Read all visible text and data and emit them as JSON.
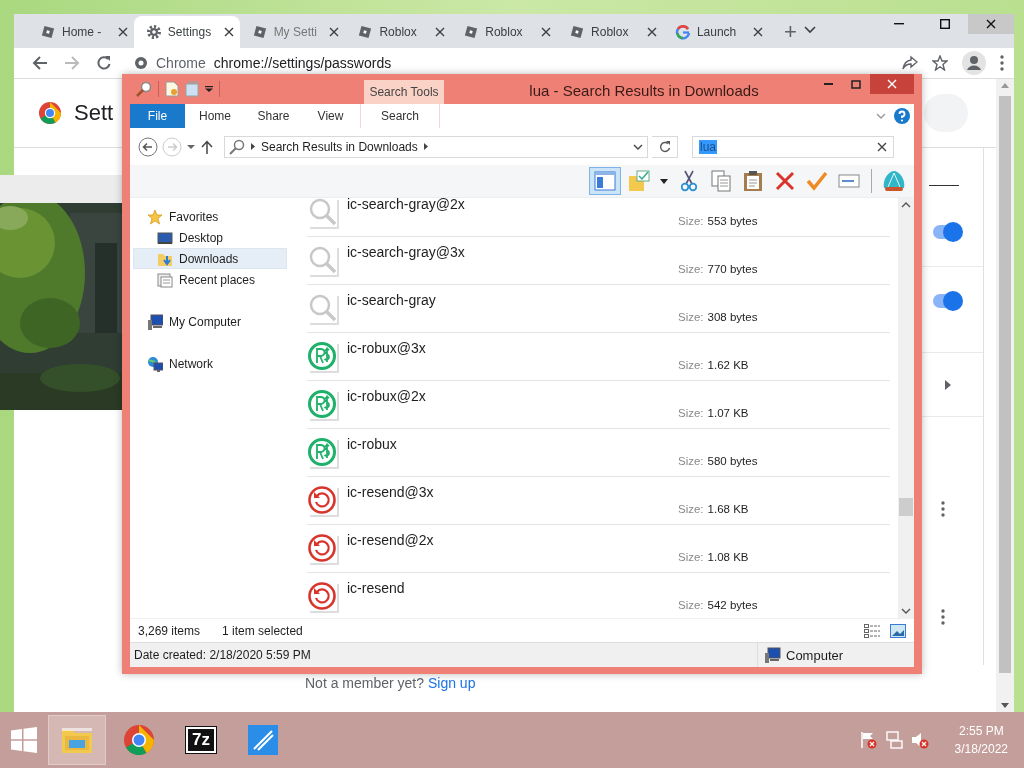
{
  "browser": {
    "tabs": [
      {
        "kind": "roblox",
        "label": "Home -",
        "selected": false
      },
      {
        "kind": "gear",
        "label": "Settings",
        "selected": true
      },
      {
        "kind": "roblox",
        "label": "My Setti",
        "selected": false
      },
      {
        "kind": "roblox",
        "label": "Roblox",
        "selected": false
      },
      {
        "kind": "roblox",
        "label": "Roblox",
        "selected": false
      },
      {
        "kind": "roblox",
        "label": "Roblox",
        "selected": false
      },
      {
        "kind": "google",
        "label": "Launch",
        "selected": false
      }
    ],
    "new_tab": "+",
    "address": {
      "site": "Chrome",
      "url": "chrome://settings/passwords"
    },
    "page_title": "Sett",
    "toggles": [
      {
        "on": true
      },
      {
        "on": true
      }
    ],
    "signup": {
      "prompt": "Not a member yet?",
      "link": "Sign up"
    }
  },
  "explorer": {
    "title": "lua - Search Results in Downloads",
    "context_group": "Search Tools",
    "ribbon_tabs": [
      {
        "label": "File",
        "kind": "file"
      },
      {
        "label": "Home",
        "kind": "tab"
      },
      {
        "label": "Share",
        "kind": "tab"
      },
      {
        "label": "View",
        "kind": "tab"
      },
      {
        "label": "Search",
        "kind": "context"
      }
    ],
    "address": "Search Results in Downloads",
    "search": {
      "value": "lua",
      "highlighted": true
    },
    "toolbar": [
      {
        "kind": "preview-pane",
        "selected": true
      },
      {
        "kind": "folder-check",
        "selected": false
      },
      {
        "kind": "caret",
        "selected": false
      },
      {
        "kind": "scissors",
        "selected": false
      },
      {
        "kind": "copy",
        "selected": false
      },
      {
        "kind": "clipboard",
        "selected": false
      },
      {
        "kind": "delete",
        "selected": false
      },
      {
        "kind": "check",
        "selected": false
      },
      {
        "kind": "rename",
        "selected": false
      },
      {
        "kind": "shell",
        "selected": false
      }
    ],
    "nav": [
      {
        "label": "Favorites",
        "kind": "star",
        "selected": false,
        "children": [
          {
            "label": "Desktop",
            "kind": "desktop",
            "selected": false
          },
          {
            "label": "Downloads",
            "kind": "downloads",
            "selected": true
          },
          {
            "label": "Recent places",
            "kind": "recent",
            "selected": false
          }
        ]
      },
      {
        "label": "My Computer",
        "kind": "computer",
        "selected": false
      },
      {
        "label": "Network",
        "kind": "network",
        "selected": false
      }
    ],
    "files": [
      {
        "name": "ic-search-gray@2x",
        "kind": "search",
        "size_label": "Size:",
        "size": "553 bytes"
      },
      {
        "name": "ic-search-gray@3x",
        "kind": "search",
        "size_label": "Size:",
        "size": "770 bytes"
      },
      {
        "name": "ic-search-gray",
        "kind": "search",
        "size_label": "Size:",
        "size": "308 bytes"
      },
      {
        "name": "ic-robux@3x",
        "kind": "robux",
        "size_label": "Size:",
        "size": "1.62 KB"
      },
      {
        "name": "ic-robux@2x",
        "kind": "robux",
        "size_label": "Size:",
        "size": "1.07 KB"
      },
      {
        "name": "ic-robux",
        "kind": "robux",
        "size_label": "Size:",
        "size": "580 bytes"
      },
      {
        "name": "ic-resend@3x",
        "kind": "resend",
        "size_label": "Size:",
        "size": "1.68 KB"
      },
      {
        "name": "ic-resend@2x",
        "kind": "resend",
        "size_label": "Size:",
        "size": "1.08 KB"
      },
      {
        "name": "ic-resend",
        "kind": "resend",
        "size_label": "Size:",
        "size": "542 bytes"
      }
    ],
    "status": {
      "count": "3,269 items",
      "selection": "1 item selected"
    },
    "details": {
      "text": "Date created: 2/18/2020 5:59 PM",
      "location": "Computer"
    }
  },
  "taskbar": {
    "apps": [
      {
        "kind": "explorer",
        "active": true
      },
      {
        "kind": "chrome",
        "active": false
      },
      {
        "kind": "sevenzip",
        "label": "7z",
        "active": false
      },
      {
        "kind": "roblox",
        "active": false
      }
    ],
    "tray": [
      {
        "kind": "flag"
      },
      {
        "kind": "network"
      },
      {
        "kind": "speaker"
      }
    ],
    "time": "2:55 PM",
    "date": "3/18/2022"
  }
}
